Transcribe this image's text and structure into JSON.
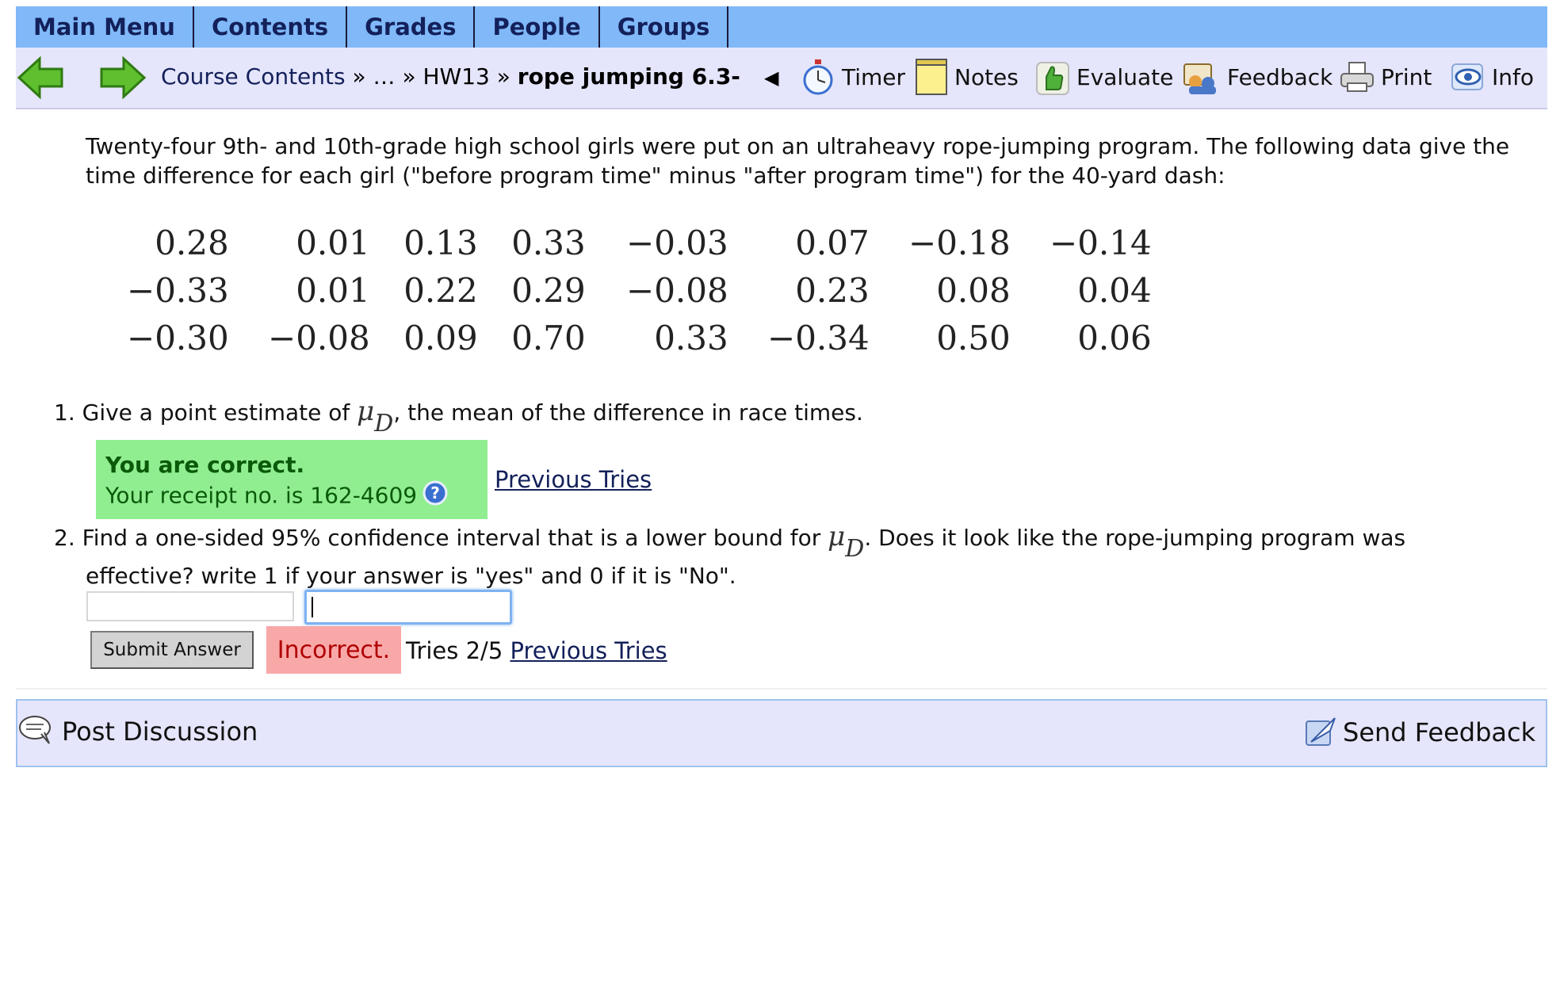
{
  "menu": {
    "items": [
      "Main Menu",
      "Contents",
      "Grades",
      "People",
      "Groups"
    ]
  },
  "nav": {
    "breadcrumb": {
      "course_contents": "Course Contents",
      "sep1": " » … » ",
      "hw": "HW13",
      "sep2": " » ",
      "current": "rope jumping 6.3-"
    },
    "prev_symbol": "◀",
    "tools": {
      "timer": "Timer",
      "notes": "Notes",
      "evaluate": "Evaluate",
      "feedback": "Feedback",
      "print": "Print",
      "info": "Info"
    },
    "icons": [
      "back-arrow-icon",
      "forward-arrow-icon",
      "stopwatch-icon",
      "notepad-icon",
      "thumbs-up-icon",
      "feedback-icon",
      "printer-icon",
      "info-eye-icon"
    ]
  },
  "problem": {
    "intro": "Twenty-four 9th- and 10th-grade high school girls were put on an ultraheavy rope-jumping program. The following data give the time difference for each girl (\"before program time\" minus \"after program time\") for the 40-yard dash:",
    "data_rows": [
      [
        "0.28",
        "0.01",
        "0.13",
        "0.33",
        "−0.03",
        "0.07",
        "−0.18",
        "−0.14"
      ],
      [
        "−0.33",
        "0.01",
        "0.22",
        "0.29",
        "−0.08",
        "0.23",
        "0.08",
        "0.04"
      ],
      [
        "−0.30",
        "−0.08",
        "0.09",
        "0.70",
        "0.33",
        "−0.34",
        "0.50",
        "0.06"
      ]
    ],
    "q1": {
      "number": "1.",
      "before": "Give a point estimate of ",
      "mu": "μ",
      "sub": "D",
      "after": ", the mean of the difference in race times.",
      "result_title": "You are correct.",
      "receipt": "Your receipt no. is 162-4609",
      "previous_tries": "Previous Tries"
    },
    "q2": {
      "number": "2.",
      "before": "Find a one-sided 95% confidence interval that is a lower bound for ",
      "mu": "μ",
      "sub": "D",
      "after": ". Does it look like the rope-jumping program was",
      "line2": "effective? write 1 if your answer is \"yes\" and 0 if it is \"No\".",
      "input1_value": "",
      "input2_value": "",
      "submit_label": "Submit Answer",
      "status": "Incorrect.",
      "tries": "Tries 2/5 ",
      "previous_tries": "Previous Tries"
    }
  },
  "footer": {
    "post_discussion": "Post Discussion",
    "send_feedback": "Send Feedback"
  },
  "colors": {
    "menubar": "#80b8f8",
    "navbar": "#e5e5fb",
    "correct_bg": "#90ee90",
    "incorrect_bg": "#f9a8a8",
    "link": "#13205a"
  }
}
